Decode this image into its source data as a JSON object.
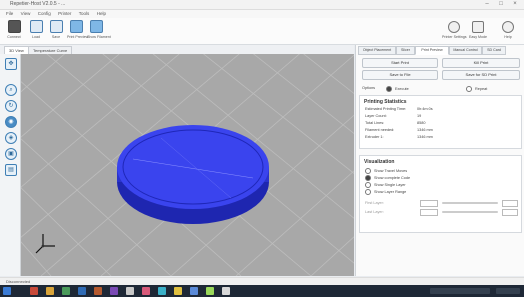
{
  "window": {
    "title": "Repetier-Host V2.0.5 - ..."
  },
  "menu": [
    "File",
    "View",
    "Config",
    "Printer",
    "Tools",
    "Help"
  ],
  "toolbar_left": [
    {
      "label": "Connect",
      "icon": "plug-icon"
    },
    {
      "label": "Load",
      "icon": "load-icon"
    },
    {
      "label": "Save",
      "icon": "save-icon"
    },
    {
      "label": "Print Preview",
      "icon": "print-preview-icon"
    },
    {
      "label": "Show Filament",
      "icon": "filament-icon"
    }
  ],
  "toolbar_right": [
    {
      "label": "Printer Settings",
      "icon": "gear-icon"
    },
    {
      "label": "Easy Mode",
      "icon": "monitor-icon"
    },
    {
      "label": "Help",
      "icon": "help-icon"
    }
  ],
  "view_tabs": [
    "3D View",
    "Temperature Curve"
  ],
  "left_tools": [
    "move-view-icon",
    "zoom-icon",
    "rotate-icon",
    "fit-icon",
    "isometric-icon",
    "top-view-icon",
    "front-view-icon"
  ],
  "panel": {
    "tabs": [
      "Object Placement",
      "Slicer",
      "Print Preview",
      "Manual Control",
      "SD Card"
    ],
    "active_tab": 2,
    "buttons": [
      "Start Print",
      "Kill Print",
      "Save to File",
      "Save for SD Print",
      "Stop",
      "Pause"
    ],
    "options_label": "Options",
    "options": [
      {
        "label": "Execute",
        "checked": true
      },
      {
        "label": "Repeat",
        "checked": false
      }
    ],
    "stats_title": "Printing Statistics",
    "stats": [
      {
        "k": "Estimated Printing Time:",
        "v": "0h:4m:0s"
      },
      {
        "k": "Layer Count:",
        "v": "19"
      },
      {
        "k": "Total Lines:",
        "v": "8580"
      },
      {
        "k": "Filament needed:",
        "v": "1346 mm"
      },
      {
        "k": "Extruder 1:",
        "v": "1346 mm"
      }
    ],
    "vis_title": "Visualization",
    "vis_options": [
      {
        "label": "Show Travel Moves",
        "checked": false
      },
      {
        "label": "Show complete Code",
        "checked": true
      },
      {
        "label": "Show Single Layer",
        "checked": false
      },
      {
        "label": "Show Layer Range",
        "checked": false
      }
    ],
    "sliders": [
      {
        "label": "First Layer:"
      },
      {
        "label": "Last Layer:"
      }
    ]
  },
  "status": {
    "text": "Disconnected"
  },
  "colors": {
    "model": "#2f3ae0",
    "model_edge": "#1a20a8",
    "viewport": "#a9a9a9",
    "grid": "#b9b9b9"
  }
}
